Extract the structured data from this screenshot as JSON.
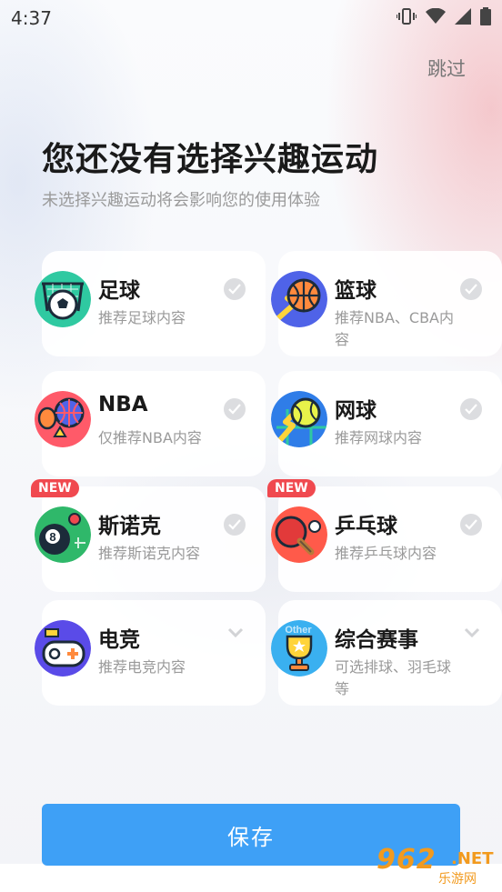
{
  "status_bar": {
    "time": "4:37"
  },
  "header": {
    "skip_label": "跳过",
    "title": "您还没有选择兴趣运动",
    "subtitle": "未选择兴趣运动将会影响您的使用体验"
  },
  "cards": [
    {
      "name": "足球",
      "desc": "推荐足球内容",
      "control": "check",
      "icon": "soccer-icon"
    },
    {
      "name": "篮球",
      "desc": "推荐NBA、CBA内容",
      "control": "check",
      "icon": "basketball-icon"
    },
    {
      "name": "NBA",
      "desc": "仅推荐NBA内容",
      "control": "check",
      "icon": "nba-icon"
    },
    {
      "name": "网球",
      "desc": "推荐网球内容",
      "control": "check",
      "icon": "tennis-icon"
    },
    {
      "name": "斯诺克",
      "desc": "推荐斯诺克内容",
      "control": "check",
      "icon": "snooker-icon",
      "badge": "NEW"
    },
    {
      "name": "乒乓球",
      "desc": "推荐乒乓球内容",
      "control": "check",
      "icon": "ping-pong-icon",
      "badge": "NEW"
    },
    {
      "name": "电竞",
      "desc": "推荐电竞内容",
      "control": "chevron",
      "icon": "esports-icon"
    },
    {
      "name": "综合赛事",
      "desc": "可选排球、羽毛球等",
      "control": "chevron",
      "icon": "trophy-icon",
      "icon_text": "Other"
    }
  ],
  "footer": {
    "save_label": "保存"
  },
  "watermark": {
    "number": "962",
    "suffix": ".NET",
    "site": "乐游网"
  },
  "colors": {
    "accent": "#3ea0f6",
    "badge": "#f0494f"
  }
}
